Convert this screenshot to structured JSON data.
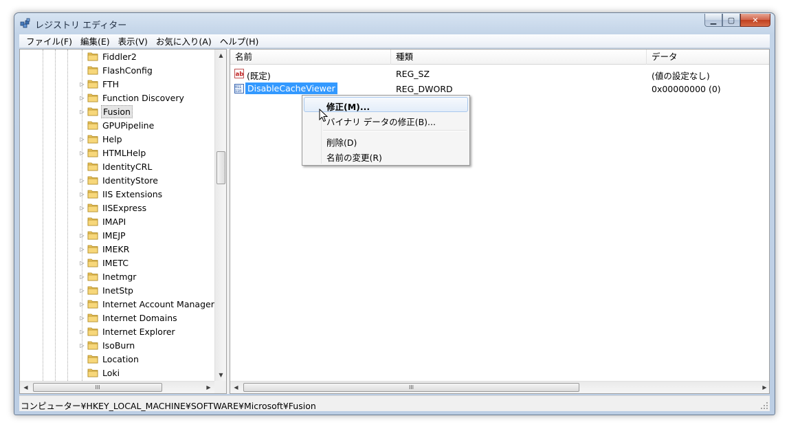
{
  "window": {
    "title": "レジストリ エディター"
  },
  "caption": {
    "minimize": "▁",
    "maximize": "▢",
    "close": "✕"
  },
  "menu": [
    "ファイル(F)",
    "編集(E)",
    "表示(V)",
    "お気に入り(A)",
    "ヘルプ(H)"
  ],
  "tree": {
    "items": [
      {
        "label": "Fiddler2",
        "expandable": false
      },
      {
        "label": "FlashConfig",
        "expandable": false
      },
      {
        "label": "FTH",
        "expandable": true
      },
      {
        "label": "Function Discovery",
        "expandable": true
      },
      {
        "label": "Fusion",
        "expandable": true,
        "selected": true
      },
      {
        "label": "GPUPipeline",
        "expandable": false
      },
      {
        "label": "Help",
        "expandable": true
      },
      {
        "label": "HTMLHelp",
        "expandable": true
      },
      {
        "label": "IdentityCRL",
        "expandable": false
      },
      {
        "label": "IdentityStore",
        "expandable": true
      },
      {
        "label": "IIS Extensions",
        "expandable": true
      },
      {
        "label": "IISExpress",
        "expandable": true
      },
      {
        "label": "IMAPI",
        "expandable": false
      },
      {
        "label": "IMEJP",
        "expandable": true
      },
      {
        "label": "IMEKR",
        "expandable": true
      },
      {
        "label": "IMETC",
        "expandable": true
      },
      {
        "label": "Inetmgr",
        "expandable": true
      },
      {
        "label": "InetStp",
        "expandable": true
      },
      {
        "label": "Internet Account Manager",
        "expandable": true
      },
      {
        "label": "Internet Domains",
        "expandable": true
      },
      {
        "label": "Internet Explorer",
        "expandable": true
      },
      {
        "label": "IsoBurn",
        "expandable": true
      },
      {
        "label": "Location",
        "expandable": false
      },
      {
        "label": "Loki",
        "expandable": false
      }
    ]
  },
  "list": {
    "columns": [
      "名前",
      "種類",
      "データ"
    ],
    "rows": [
      {
        "name": "(既定)",
        "type": "REG_SZ",
        "data": "(値の設定なし)",
        "icon": "string-value-icon"
      },
      {
        "name": "DisableCacheViewer",
        "type": "REG_DWORD",
        "data": "0x00000000 (0)",
        "icon": "binary-value-icon",
        "selected": true
      }
    ]
  },
  "context_menu": {
    "items": [
      "修正(M)...",
      "バイナリ データの修正(B)...",
      "削除(D)",
      "名前の変更(R)"
    ],
    "highlighted": "修正(M)..."
  },
  "scroll_glyphs": {
    "up": "▲",
    "down": "▼",
    "left": "◀",
    "right": "▶",
    "grip": "III"
  },
  "status": {
    "path": "コンピューター¥HKEY_LOCAL_MACHINE¥SOFTWARE¥Microsoft¥Fusion"
  }
}
